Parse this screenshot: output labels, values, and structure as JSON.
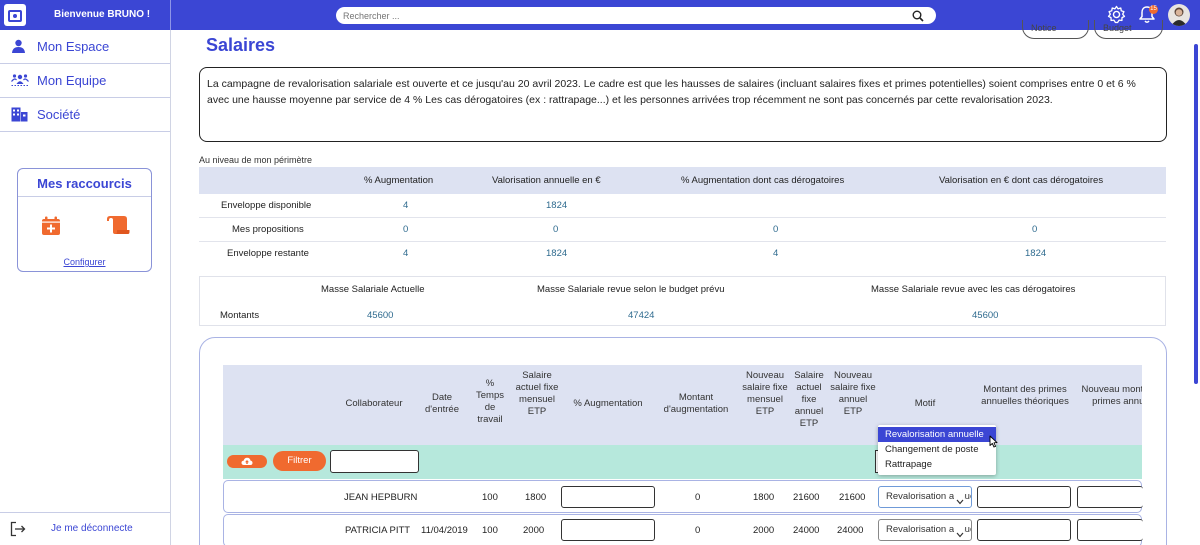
{
  "header": {
    "welcome": "Bienvenue BRUNO !",
    "search_placeholder": "Rechercher ...",
    "notification_count": "15",
    "accent_color": "#3b46d4"
  },
  "sidebar": {
    "items": [
      {
        "label": "Mon Espace",
        "icon": "user-icon"
      },
      {
        "label": "Mon Equipe",
        "icon": "team-icon"
      },
      {
        "label": "Société",
        "icon": "building-icon"
      }
    ],
    "shortcuts": {
      "title": "Mes raccourcis",
      "icons": [
        "calendar-add-icon",
        "scroll-icon"
      ],
      "configure": "Configurer"
    },
    "logout": "Je me déconnecte"
  },
  "page": {
    "title": "Salaires",
    "header_buttons": [
      "Notice",
      "Budget"
    ],
    "info_text": "La campagne de revalorisation salariale est ouverte et ce jusqu'au 20 avril 2023. Le cadre est que les hausses de salaires (incluant salaires fixes et primes potentielles) soient comprises entre 0 et 6 % avec une hausse moyenne par service de 4 % Les cas dérogatoires (ex : rattrapage...) et les personnes arrivées trop récemment ne sont pas concernés par cette revalorisation 2023.",
    "perimeter_label": "Au niveau de mon périmètre"
  },
  "budget_table": {
    "headers": [
      "% Augmentation",
      "Valorisation annuelle en €",
      "% Augmentation dont cas dérogatoires",
      "Valorisation en € dont cas dérogatoires"
    ],
    "rows": [
      {
        "label": "Enveloppe disponible",
        "values": [
          "4",
          "1824",
          "",
          ""
        ]
      },
      {
        "label": "Mes propositions",
        "values": [
          "0",
          "0",
          "0",
          "0"
        ]
      },
      {
        "label": "Enveloppe restante",
        "values": [
          "4",
          "1824",
          "4",
          "1824"
        ]
      }
    ]
  },
  "mass_table": {
    "headers": [
      "Masse Salariale Actuelle",
      "Masse Salariale revue selon le budget prévu",
      "Masse Salariale revue avec les cas dérogatoires"
    ],
    "row_label": "Montants",
    "values": [
      "45600",
      "47424",
      "45600"
    ]
  },
  "grid": {
    "headers": [
      "Collaborateur",
      "Date d'entrée",
      "% Temps de travail",
      "Salaire actuel fixe mensuel ETP",
      "% Augmentation",
      "Montant d'augmentation",
      "Nouveau salaire fixe mensuel ETP",
      "Salaire actuel fixe annuel ETP",
      "Nouveau salaire fixe annuel ETP",
      "Motif",
      "Montant des primes annuelles théoriques",
      "Nouveau montant des primes annuelles"
    ],
    "filter_button": "Filtrer",
    "rows": [
      {
        "name": "JEAN HEPBURN",
        "date": "",
        "temps": "100",
        "salaire": "1800",
        "montant": "0",
        "nouveau_mensuel": "1800",
        "actuel_annuel": "21600",
        "nouveau_annuel": "21600",
        "motif": "Revalorisation annuelle"
      },
      {
        "name": "PATRICIA PITT",
        "date": "11/04/2019",
        "temps": "100",
        "salaire": "2000",
        "montant": "0",
        "nouveau_mensuel": "2000",
        "actuel_annuel": "24000",
        "nouveau_annuel": "24000",
        "motif": "Revalorisation annuelle"
      }
    ]
  },
  "motif_dropdown": {
    "options": [
      "Revalorisation annuelle",
      "Changement de poste",
      "Rattrapage"
    ],
    "selected_index": 0
  }
}
